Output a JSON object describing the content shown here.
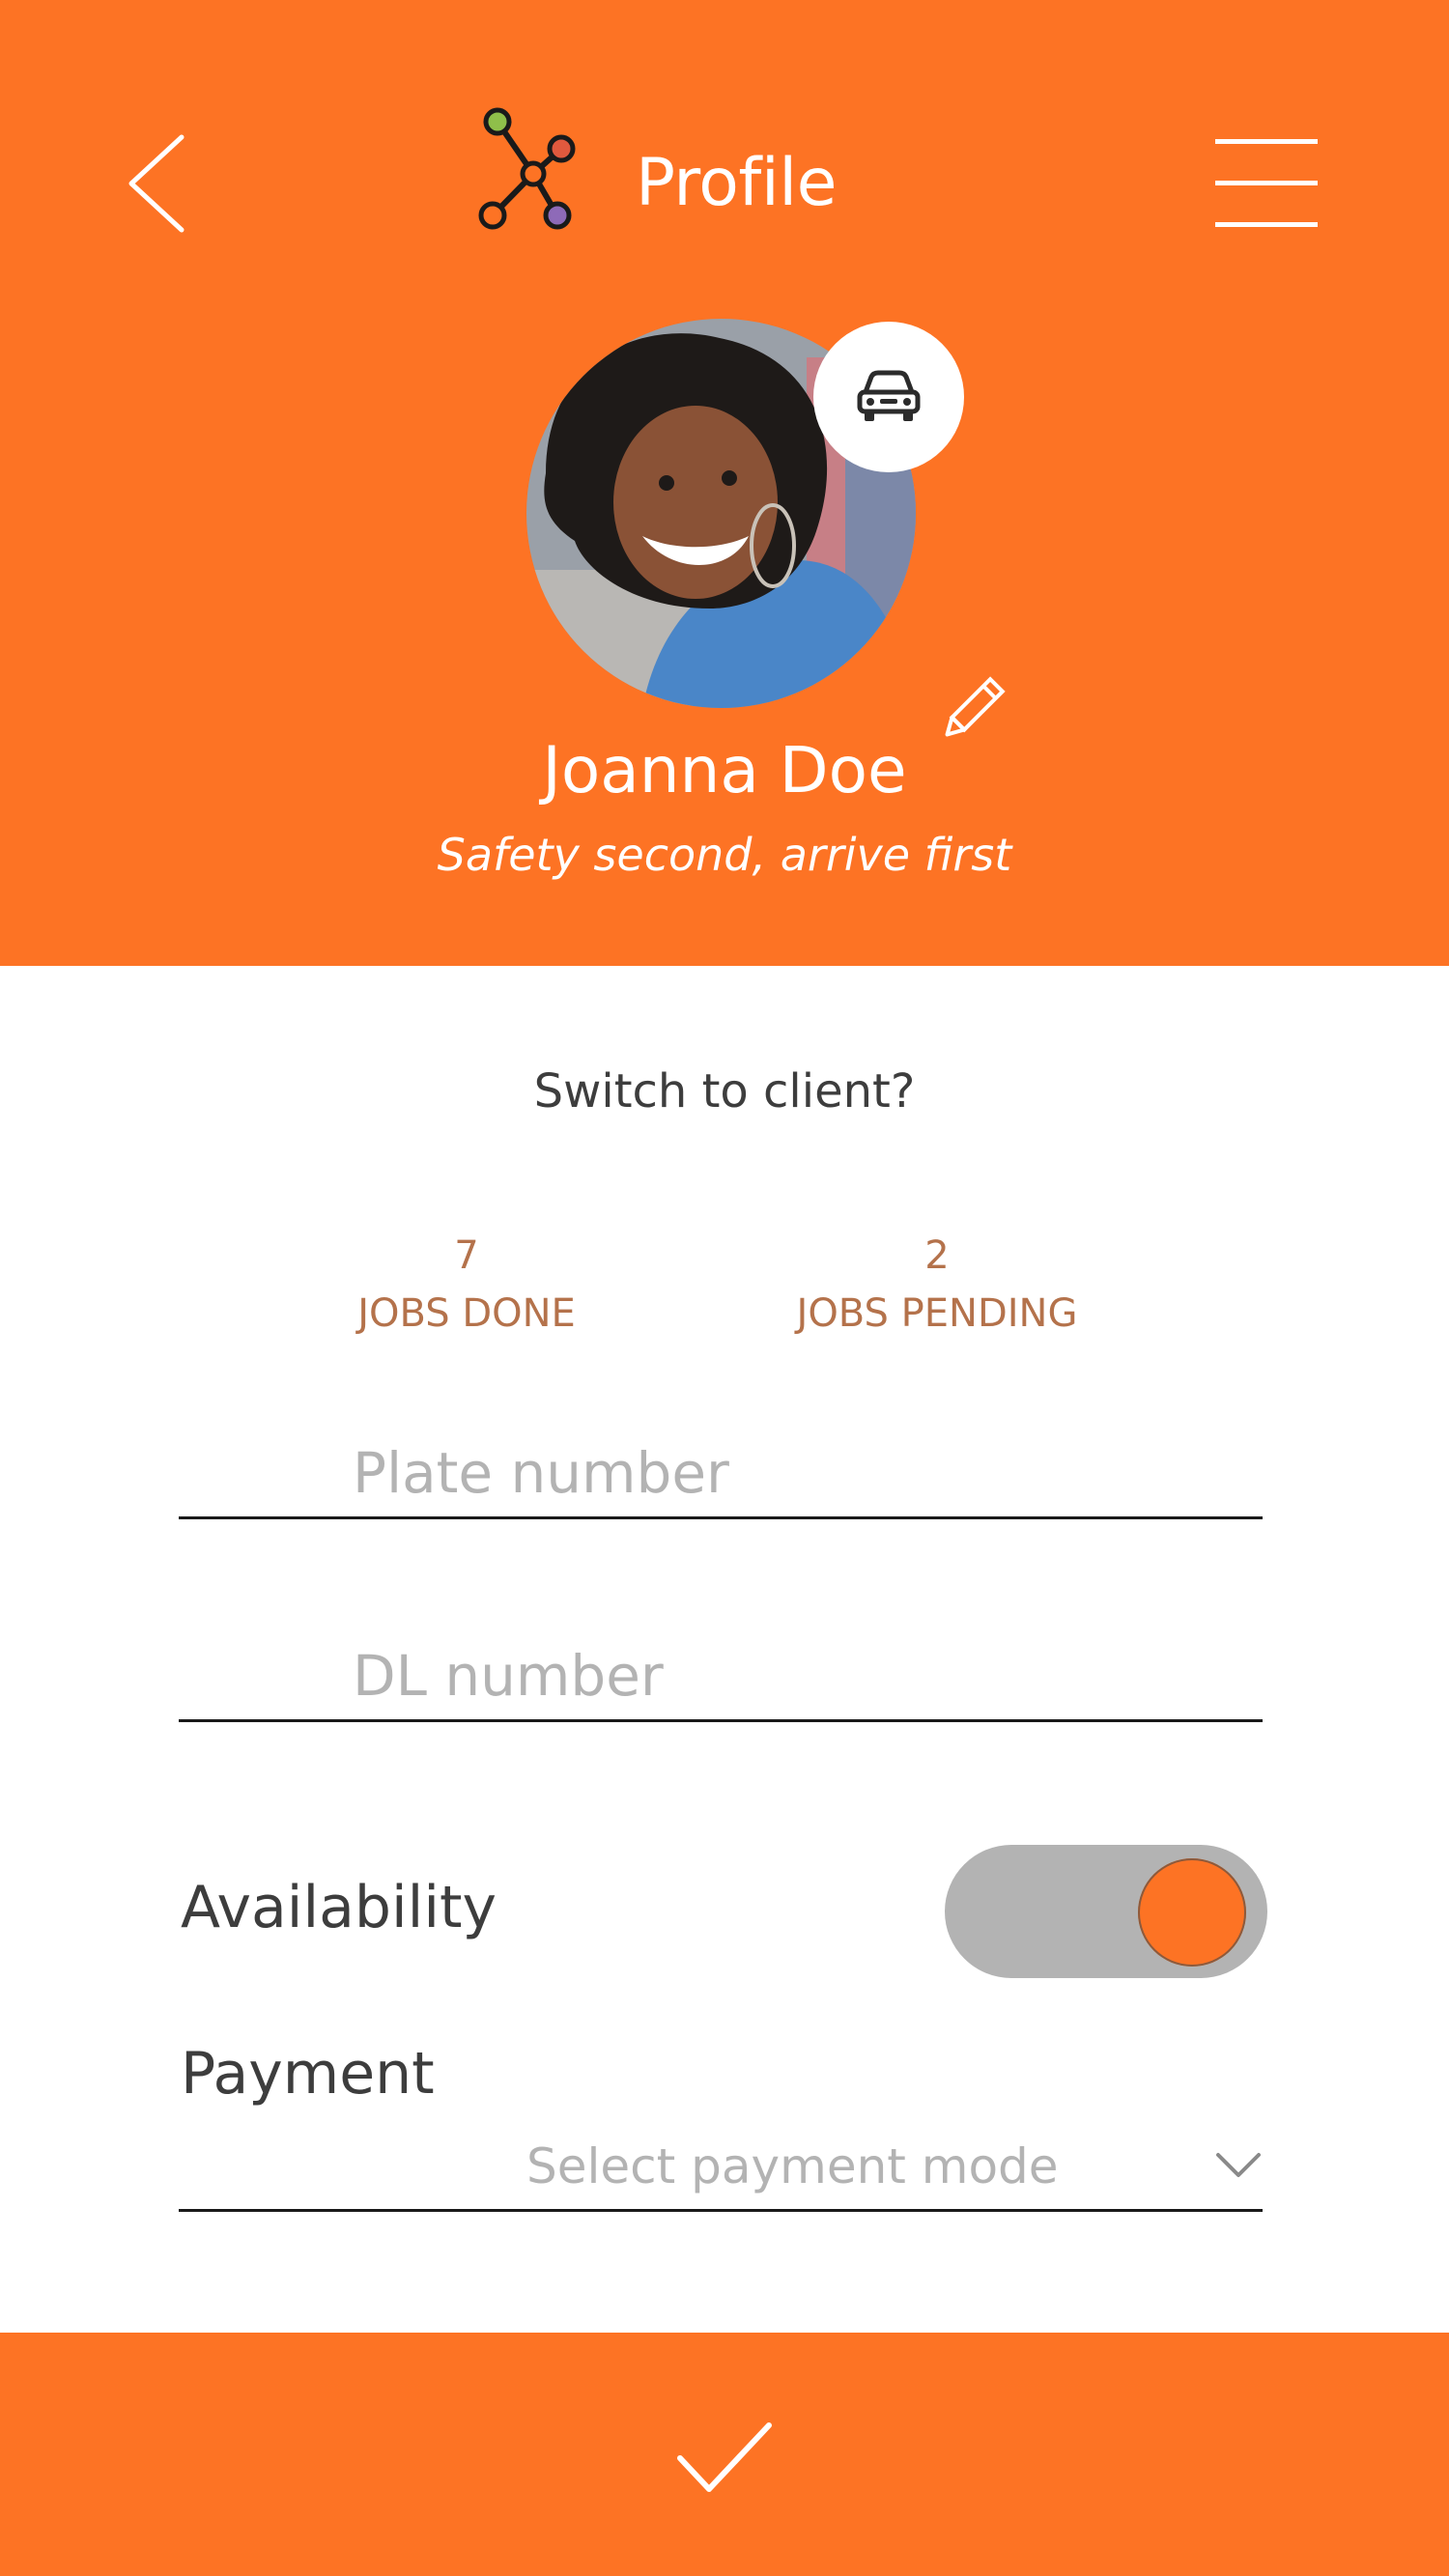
{
  "header": {
    "title": "Profile",
    "back_icon": "chevron-left-icon",
    "menu_icon": "hamburger-menu-icon",
    "logo_icon": "network-nodes-logo"
  },
  "profile": {
    "name": "Joanna Doe",
    "tagline": "Safety second, arrive first",
    "role_badge_icon": "car-icon",
    "edit_icon": "pencil-icon"
  },
  "switch_prompt": "Switch to client?",
  "stats": [
    {
      "value": "7",
      "label": "JOBS DONE"
    },
    {
      "value": "2",
      "label": "JOBS PENDING"
    }
  ],
  "fields": {
    "plate": {
      "placeholder": "Plate number",
      "value": ""
    },
    "dl": {
      "placeholder": "DL number",
      "value": ""
    }
  },
  "availability": {
    "label": "Availability",
    "enabled": true
  },
  "payment": {
    "label": "Payment",
    "placeholder": "Select payment mode"
  },
  "footer": {
    "confirm_icon": "checkmark-icon"
  },
  "colors": {
    "accent": "#FD7324",
    "toggle_track": "#B3B3B3",
    "text_dark": "#3D3D3D",
    "placeholder": "#B3B3B3",
    "stat_text": "#B4724B"
  }
}
